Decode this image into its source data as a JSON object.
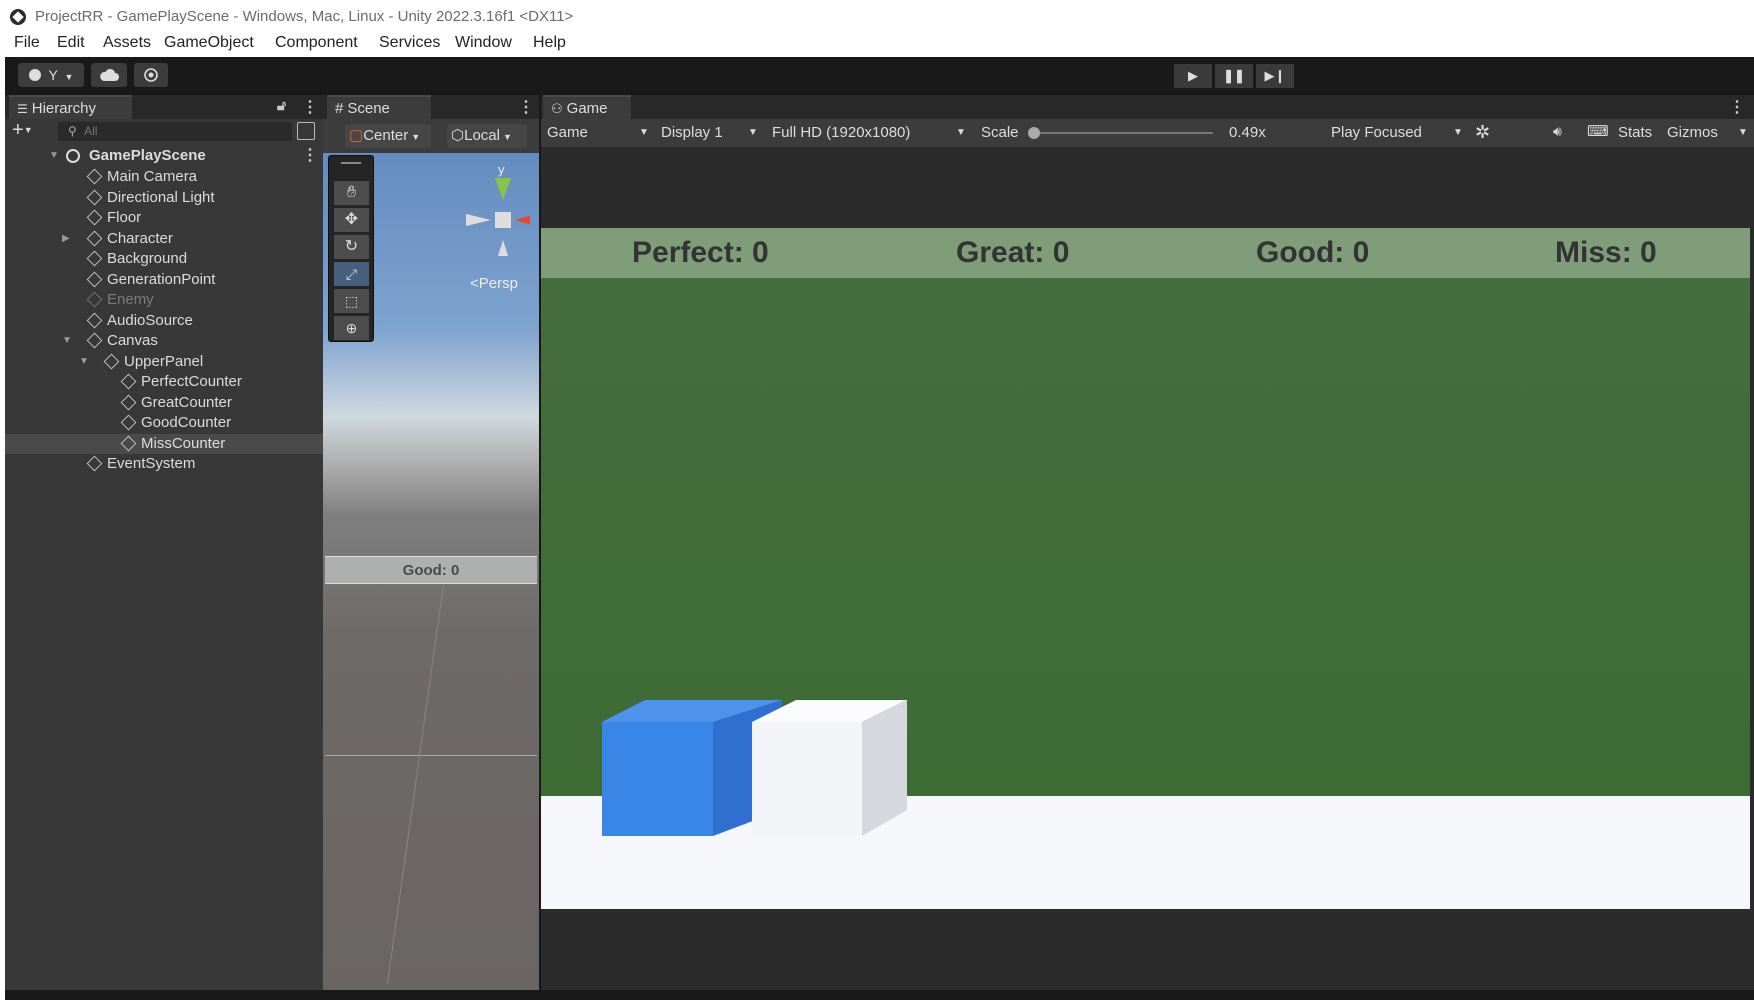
{
  "window": {
    "title": "ProjectRR - GamePlayScene - Windows, Mac, Linux - Unity 2022.3.16f1 <DX11>"
  },
  "menu": [
    "File",
    "Edit",
    "Assets",
    "GameObject",
    "Component",
    "Services",
    "Window",
    "Help"
  ],
  "toolbar": {
    "account_label": "Y",
    "play_icon": "play-icon",
    "pause_icon": "pause-icon",
    "step_icon": "step-icon"
  },
  "hierarchy": {
    "tab_label": "Hierarchy",
    "search_placeholder": "All",
    "scene_name": "GamePlayScene",
    "items": [
      {
        "label": "Main Camera",
        "depth": 1,
        "expander": "",
        "active": true
      },
      {
        "label": "Directional Light",
        "depth": 1,
        "expander": "",
        "active": true
      },
      {
        "label": "Floor",
        "depth": 1,
        "expander": "",
        "active": true
      },
      {
        "label": "Character",
        "depth": 1,
        "expander": "collapsed",
        "active": true
      },
      {
        "label": "Background",
        "depth": 1,
        "expander": "",
        "active": true
      },
      {
        "label": "GenerationPoint",
        "depth": 1,
        "expander": "",
        "active": true
      },
      {
        "label": "Enemy",
        "depth": 1,
        "expander": "",
        "active": false
      },
      {
        "label": "AudioSource",
        "depth": 1,
        "expander": "",
        "active": true
      },
      {
        "label": "Canvas",
        "depth": 1,
        "expander": "expanded",
        "active": true
      },
      {
        "label": "UpperPanel",
        "depth": 2,
        "expander": "expanded",
        "active": true
      },
      {
        "label": "PerfectCounter",
        "depth": 3,
        "expander": "",
        "active": true
      },
      {
        "label": "GreatCounter",
        "depth": 3,
        "expander": "",
        "active": true
      },
      {
        "label": "GoodCounter",
        "depth": 3,
        "expander": "",
        "active": true
      },
      {
        "label": "MissCounter",
        "depth": 3,
        "expander": "",
        "active": true,
        "selected": true
      },
      {
        "label": "EventSystem",
        "depth": 1,
        "expander": "",
        "active": true
      }
    ]
  },
  "scene": {
    "tab_label": "Scene",
    "pivot_label": "Center",
    "space_label": "Local",
    "gizmo_axis_label": "y",
    "persp_label": "Persp",
    "world_text": "Good: 0"
  },
  "game": {
    "tab_label": "Game",
    "mode_label": "Game",
    "display_label": "Display 1",
    "resolution_label": "Full HD (1920x1080)",
    "scale_label": "Scale",
    "scale_value": "0.49x",
    "play_mode_label": "Play Focused",
    "stats_label": "Stats",
    "gizmos_label": "Gizmos",
    "hud": {
      "perfect": "Perfect: 0",
      "great": "Great: 0",
      "good": "Good: 0",
      "miss": "Miss: 0"
    }
  },
  "colors": {
    "editor_bg": "#191919",
    "panel_bg": "#383838",
    "game_sky": "#3d6b34",
    "hud_band": "#7e9d78",
    "player_cube": "#3a86e6",
    "enemy_cube": "#f2f4f7"
  }
}
